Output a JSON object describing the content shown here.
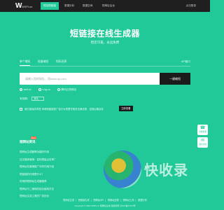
{
  "navbar": {
    "logo_mark": "W",
    "logo_text": "WSFI.cn",
    "items": [
      "短址短链接",
      "数据分析",
      "数据空间",
      "短网址后台"
    ],
    "right_link": "点击登录"
  },
  "hero": {
    "title": "短链接在线生成器",
    "subtitle": "稳定可靠，永远免费"
  },
  "tabs": [
    "单个缩短",
    "批量缩短",
    "短码还原"
  ],
  "api_link": "API接口",
  "url_input": {
    "placeholder": "请输入您的网址，如www.qq.com",
    "value": ""
  },
  "generate_button": "一键缩短",
  "domain_options": [
    "wsfi.cn",
    "s.sg.cn",
    "腾讯云短网址"
  ],
  "expire": {
    "label": "有效期：",
    "value": "永久"
  },
  "notice": {
    "text": "我已阅读并同意 申请短链接的广告行为须遵守相关法律法规，否则后果自负",
    "button": "立即查看"
  },
  "side_buttons": [
    {
      "icon": "chat-icon",
      "label": "在线客服"
    },
    {
      "icon": "shopping-icon",
      "label": "微信咨询"
    }
  ],
  "news": {
    "title": "短网址资讯",
    "badge": "New",
    "items": [
      "短网址生成器等功能的作用",
      "社交媒体营销：如何提高点击率？",
      "短网址在营销推广中的作用介绍",
      "短链接的作用是什么？",
      "好用的短网址生成器推荐",
      "短网址与二维码的结合使用方法",
      "短网址生成工具的广告优化"
    ]
  },
  "watermark": {
    "text": "快收录"
  },
  "footer": {
    "links": [
      "短网址生成",
      "短链接生成",
      "短网址API",
      "短网址还原",
      "短网址工具",
      "数据分析"
    ],
    "copyright": "Copyright © 2023 WSFI.cn 短网址生成 版权所有 沪ICP备XXXX号"
  }
}
